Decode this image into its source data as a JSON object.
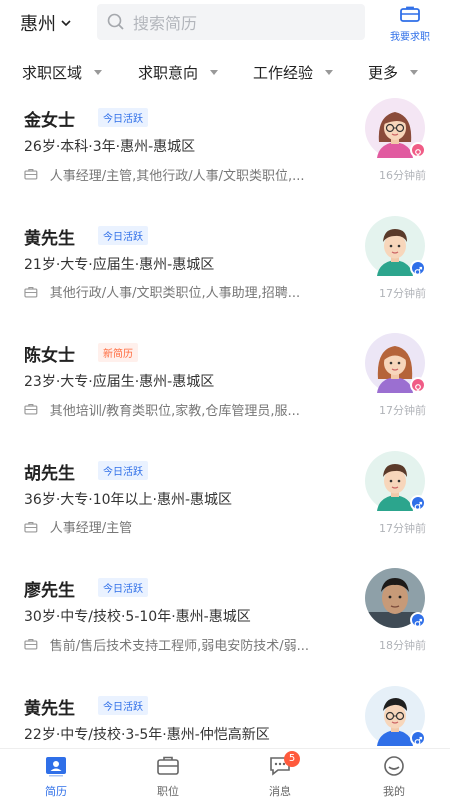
{
  "header": {
    "city": "惠州",
    "search_placeholder": "搜索简历",
    "job_button_label": "我要求职"
  },
  "filters": [
    "求职区域",
    "求职意向",
    "工作经验",
    "更多"
  ],
  "candidates": [
    {
      "name": "金女士",
      "badge": "今日活跃",
      "badge_type": "active",
      "meta": "26岁·本科·3年·惠州-惠城区",
      "intent": "人事经理/主管,其他行政/人事/文职类职位,...",
      "time": "16分钟前",
      "gender": "female"
    },
    {
      "name": "黄先生",
      "badge": "今日活跃",
      "badge_type": "active",
      "meta": "21岁·大专·应届生·惠州-惠城区",
      "intent": "其他行政/人事/文职类职位,人事助理,招聘...",
      "time": "17分钟前",
      "gender": "male"
    },
    {
      "name": "陈女士",
      "badge": "新简历",
      "badge_type": "new",
      "meta": "23岁·大专·应届生·惠州-惠城区",
      "intent": "其他培训/教育类职位,家教,仓库管理员,服...",
      "time": "17分钟前",
      "gender": "female"
    },
    {
      "name": "胡先生",
      "badge": "今日活跃",
      "badge_type": "active",
      "meta": "36岁·大专·10年以上·惠州-惠城区",
      "intent": "人事经理/主管",
      "time": "17分钟前",
      "gender": "male"
    },
    {
      "name": "廖先生",
      "badge": "今日活跃",
      "badge_type": "active",
      "meta": "30岁·中专/技校·5-10年·惠州-惠城区",
      "intent": "售前/售后技术支持工程师,弱电安防技术/弱...",
      "time": "18分钟前",
      "gender": "male"
    },
    {
      "name": "黄先生",
      "badge": "今日活跃",
      "badge_type": "active",
      "meta": "22岁·中专/技校·3-5年·惠州-仲恺高新区",
      "intent": "",
      "time": "",
      "gender": "male"
    }
  ],
  "nav": {
    "items": [
      "简历",
      "职位",
      "消息",
      "我的"
    ],
    "active": "简历",
    "message_count": "5"
  },
  "colors": {
    "accent": "#2f6fe8",
    "female": "#f05c86",
    "male": "#2f6fe8",
    "badge_new": "#ff6a3d"
  }
}
